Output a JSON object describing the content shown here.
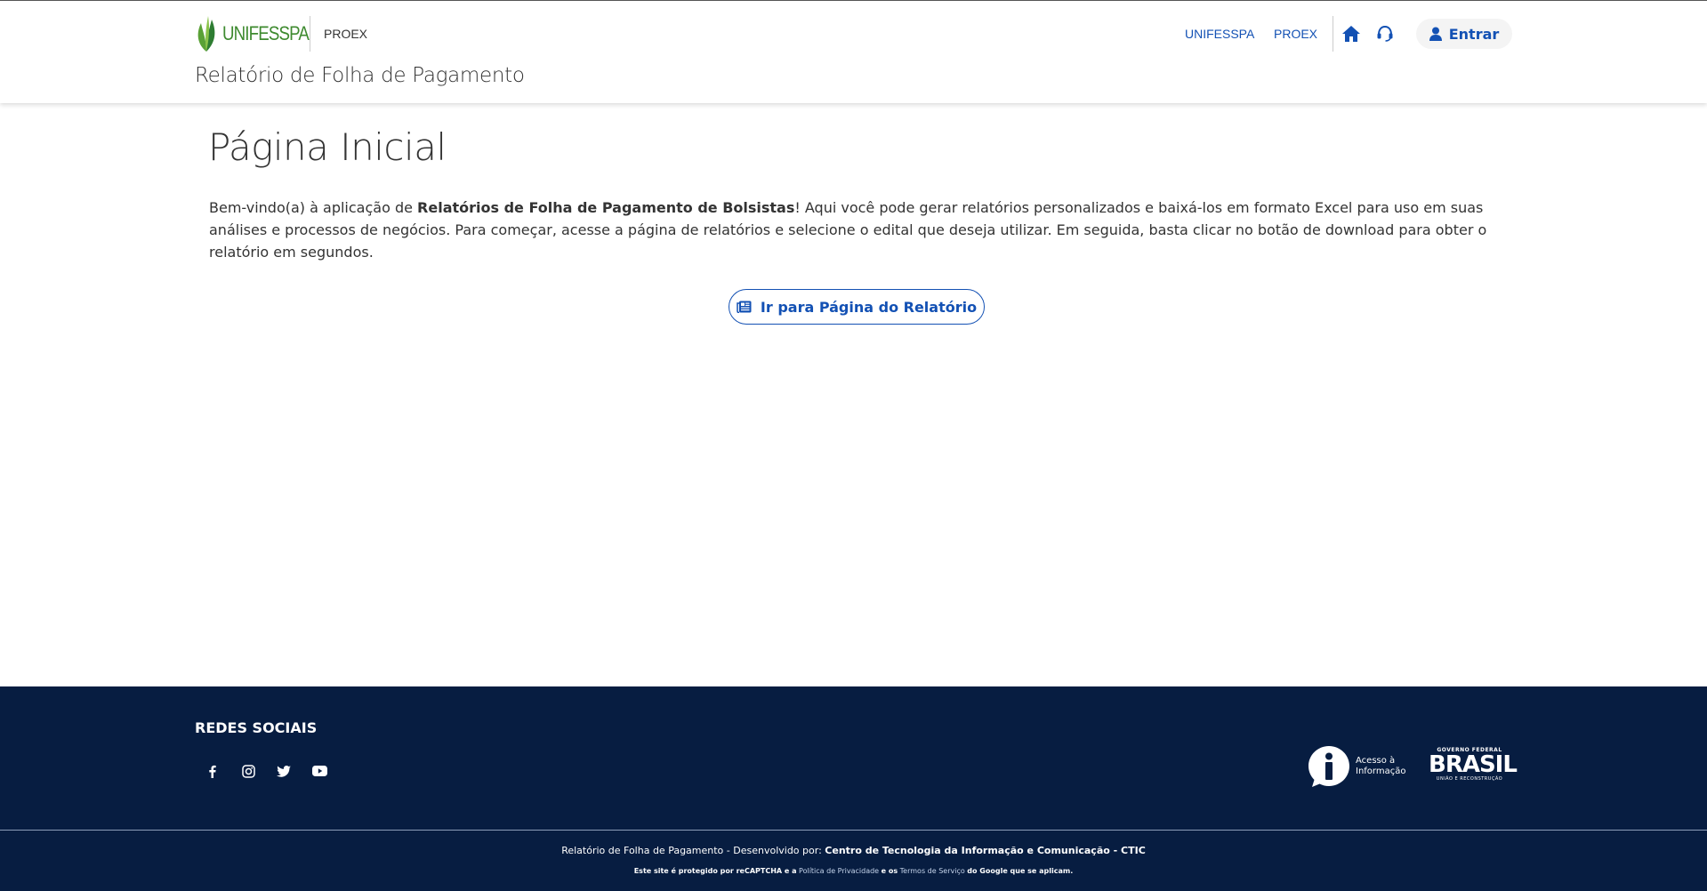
{
  "header": {
    "logo_text": "UNIFESSPA",
    "subtitle": "PROEX",
    "title": "Relatório de Folha de Pagamento",
    "nav": [
      {
        "label": "UNIFESSPA"
      },
      {
        "label": "PROEX"
      }
    ],
    "login_label": "Entrar",
    "accent_color": "#1351b4"
  },
  "main": {
    "title": "Página Inicial",
    "intro_before": "Bem-vindo(a) à aplicação de ",
    "intro_bold": "Relatórios de Folha de Pagamento de Bolsistas",
    "intro_after": "! Aqui você pode gerar relatórios personalizados e baixá-los em formato Excel para uso em suas análises e processos de negócios. Para começar, acesse a página de relatórios e selecione o edital que deseja utilizar. Em seguida, basta clicar no botão de download para obter o relatório em segundos.",
    "report_button_label": "Ir para Página do Relatório"
  },
  "footer": {
    "background_color": "#071d41",
    "social_title": "REDES SOCIAIS",
    "social_icons": [
      "facebook-icon",
      "instagram-icon",
      "twitter-icon",
      "youtube-icon"
    ],
    "acesso_line1": "Acesso à",
    "acesso_line2": "Informação",
    "brasil_top": "GOVERNO FEDERAL",
    "brasil_main": "BRASIL",
    "brasil_bottom": "UNIÃO E RECONSTRUÇÃO",
    "credits_prefix": "Relatório de Folha de Pagamento - Desenvolvido por:",
    "credits_org": "Centro de Tecnologia da Informação e Comunicação - CTIC",
    "recaptcha_prefix": "Este site é protegido por reCAPTCHA e a",
    "privacy_label": "Política de Privacidade",
    "recaptcha_middle": "e os",
    "terms_label": "Termos de Serviço",
    "recaptcha_suffix": "do Google que se aplicam."
  }
}
